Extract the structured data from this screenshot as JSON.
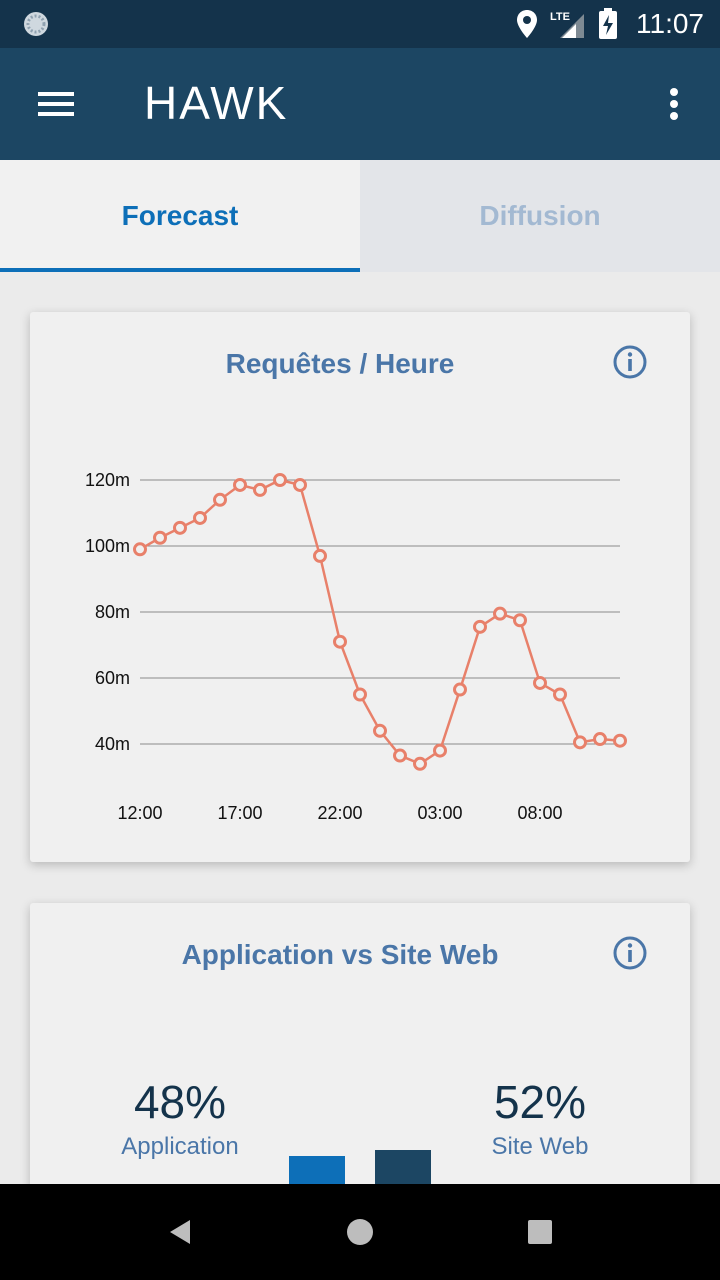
{
  "status_bar": {
    "time": "11:07",
    "network": "LTE",
    "icons": [
      "loading-spinner-icon",
      "location-pin-icon",
      "lte-signal-icon",
      "battery-charging-icon"
    ]
  },
  "app_bar": {
    "title": "HAWK",
    "icons": [
      "hamburger-menu-icon",
      "overflow-menu-icon"
    ]
  },
  "tabs": [
    {
      "label": "Forecast",
      "active": true
    },
    {
      "label": "Diffusion",
      "active": false
    }
  ],
  "cards": {
    "requests": {
      "title": "Requêtes / Heure",
      "icon": "info-icon"
    },
    "split": {
      "title": "Application vs Site Web",
      "icon": "info-icon"
    }
  },
  "chart_data": [
    {
      "type": "line",
      "title": "Requêtes / Heure",
      "x_tick_labels": [
        "12:00",
        "17:00",
        "22:00",
        "03:00",
        "08:00"
      ],
      "y_tick_labels": [
        "40m",
        "60m",
        "80m",
        "100m",
        "120m"
      ],
      "ylim": [
        40,
        120
      ],
      "grid": true,
      "color": "#e8806a",
      "series": [
        {
          "x": [
            "12:00",
            "13:00",
            "14:00",
            "15:00",
            "16:00",
            "17:00",
            "18:00",
            "19:00",
            "20:00",
            "21:00",
            "22:00",
            "23:00",
            "00:00",
            "01:00",
            "02:00",
            "03:00",
            "04:00",
            "05:00",
            "06:00",
            "07:00",
            "08:00",
            "09:00",
            "10:00",
            "11:00",
            "12:00"
          ],
          "values": [
            99,
            102.5,
            105.5,
            108.5,
            114,
            118.5,
            117,
            120,
            118.5,
            97,
            71,
            55,
            44,
            36.5,
            34,
            38,
            56.5,
            75.5,
            79.5,
            77.5,
            58.5,
            55,
            40.5,
            41.5,
            41
          ]
        }
      ]
    },
    {
      "type": "bar",
      "title": "Application vs Site Web",
      "categories": [
        "Application",
        "Site Web"
      ],
      "values": [
        48,
        52
      ],
      "colors": [
        "#0d6fb8",
        "#1c4663"
      ]
    }
  ],
  "split": {
    "app_pct": "48%",
    "app_label": "Application",
    "web_pct": "52%",
    "web_label": "Site Web"
  },
  "nav_bar": {
    "icons": [
      "back-icon",
      "home-icon",
      "recents-icon"
    ]
  }
}
